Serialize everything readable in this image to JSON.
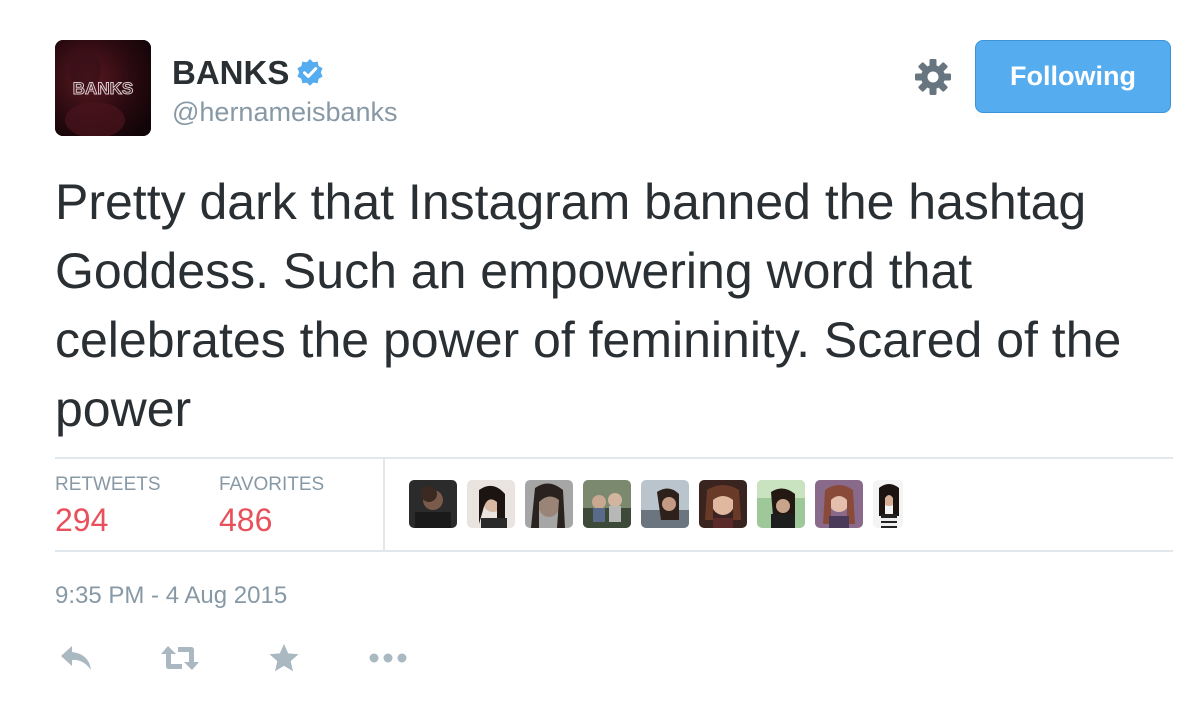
{
  "user": {
    "display_name": "BANKS",
    "handle": "@hernameisbanks",
    "avatar_text": "BANKS",
    "verified": true
  },
  "header": {
    "follow_label": "Following",
    "settings_icon": "gear-icon"
  },
  "tweet": {
    "text": "Pretty dark that Instagram banned the hashtag Goddess. Such an empowering word that celebrates the power of femininity. Scared of the power"
  },
  "stats": {
    "retweets_label": "RETWEETS",
    "retweets_count": "294",
    "favorites_label": "FAVORITES",
    "favorites_count": "486"
  },
  "favoriters_count_shown": 9,
  "timestamp": "9:35 PM - 4 Aug 2015",
  "actions": [
    {
      "name": "reply",
      "icon": "reply-icon"
    },
    {
      "name": "retweet",
      "icon": "retweet-icon"
    },
    {
      "name": "favorite",
      "icon": "star-icon"
    },
    {
      "name": "more",
      "icon": "more-dots-icon"
    }
  ],
  "colors": {
    "accent": "#55acee",
    "count": "#e8505b",
    "muted": "#8899a6",
    "text": "#292f33",
    "divider": "#e1e8ed"
  }
}
